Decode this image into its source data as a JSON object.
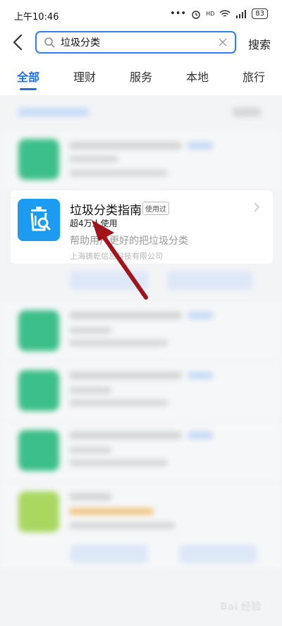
{
  "status": {
    "time": "上午10:46",
    "battery": "83",
    "network": "HD"
  },
  "search": {
    "query": "垃圾分类",
    "button": "搜索"
  },
  "tabs": [
    {
      "label": "全部"
    },
    {
      "label": "理财"
    },
    {
      "label": "服务"
    },
    {
      "label": "本地"
    },
    {
      "label": "旅行"
    }
  ],
  "result": {
    "name": "垃圾分类指南",
    "tag": "使用过",
    "users": "超4万人使用",
    "description": "帮助用户更好的把垃圾分类",
    "company": "上海铸乾信息科技有限公司"
  },
  "watermark": "Bai 经验",
  "colors": {
    "accent": "#1a73e8",
    "app_icon": "#1d9bf0",
    "arrow": "#a0141c",
    "blurred_icon": "#3dbf8a"
  }
}
